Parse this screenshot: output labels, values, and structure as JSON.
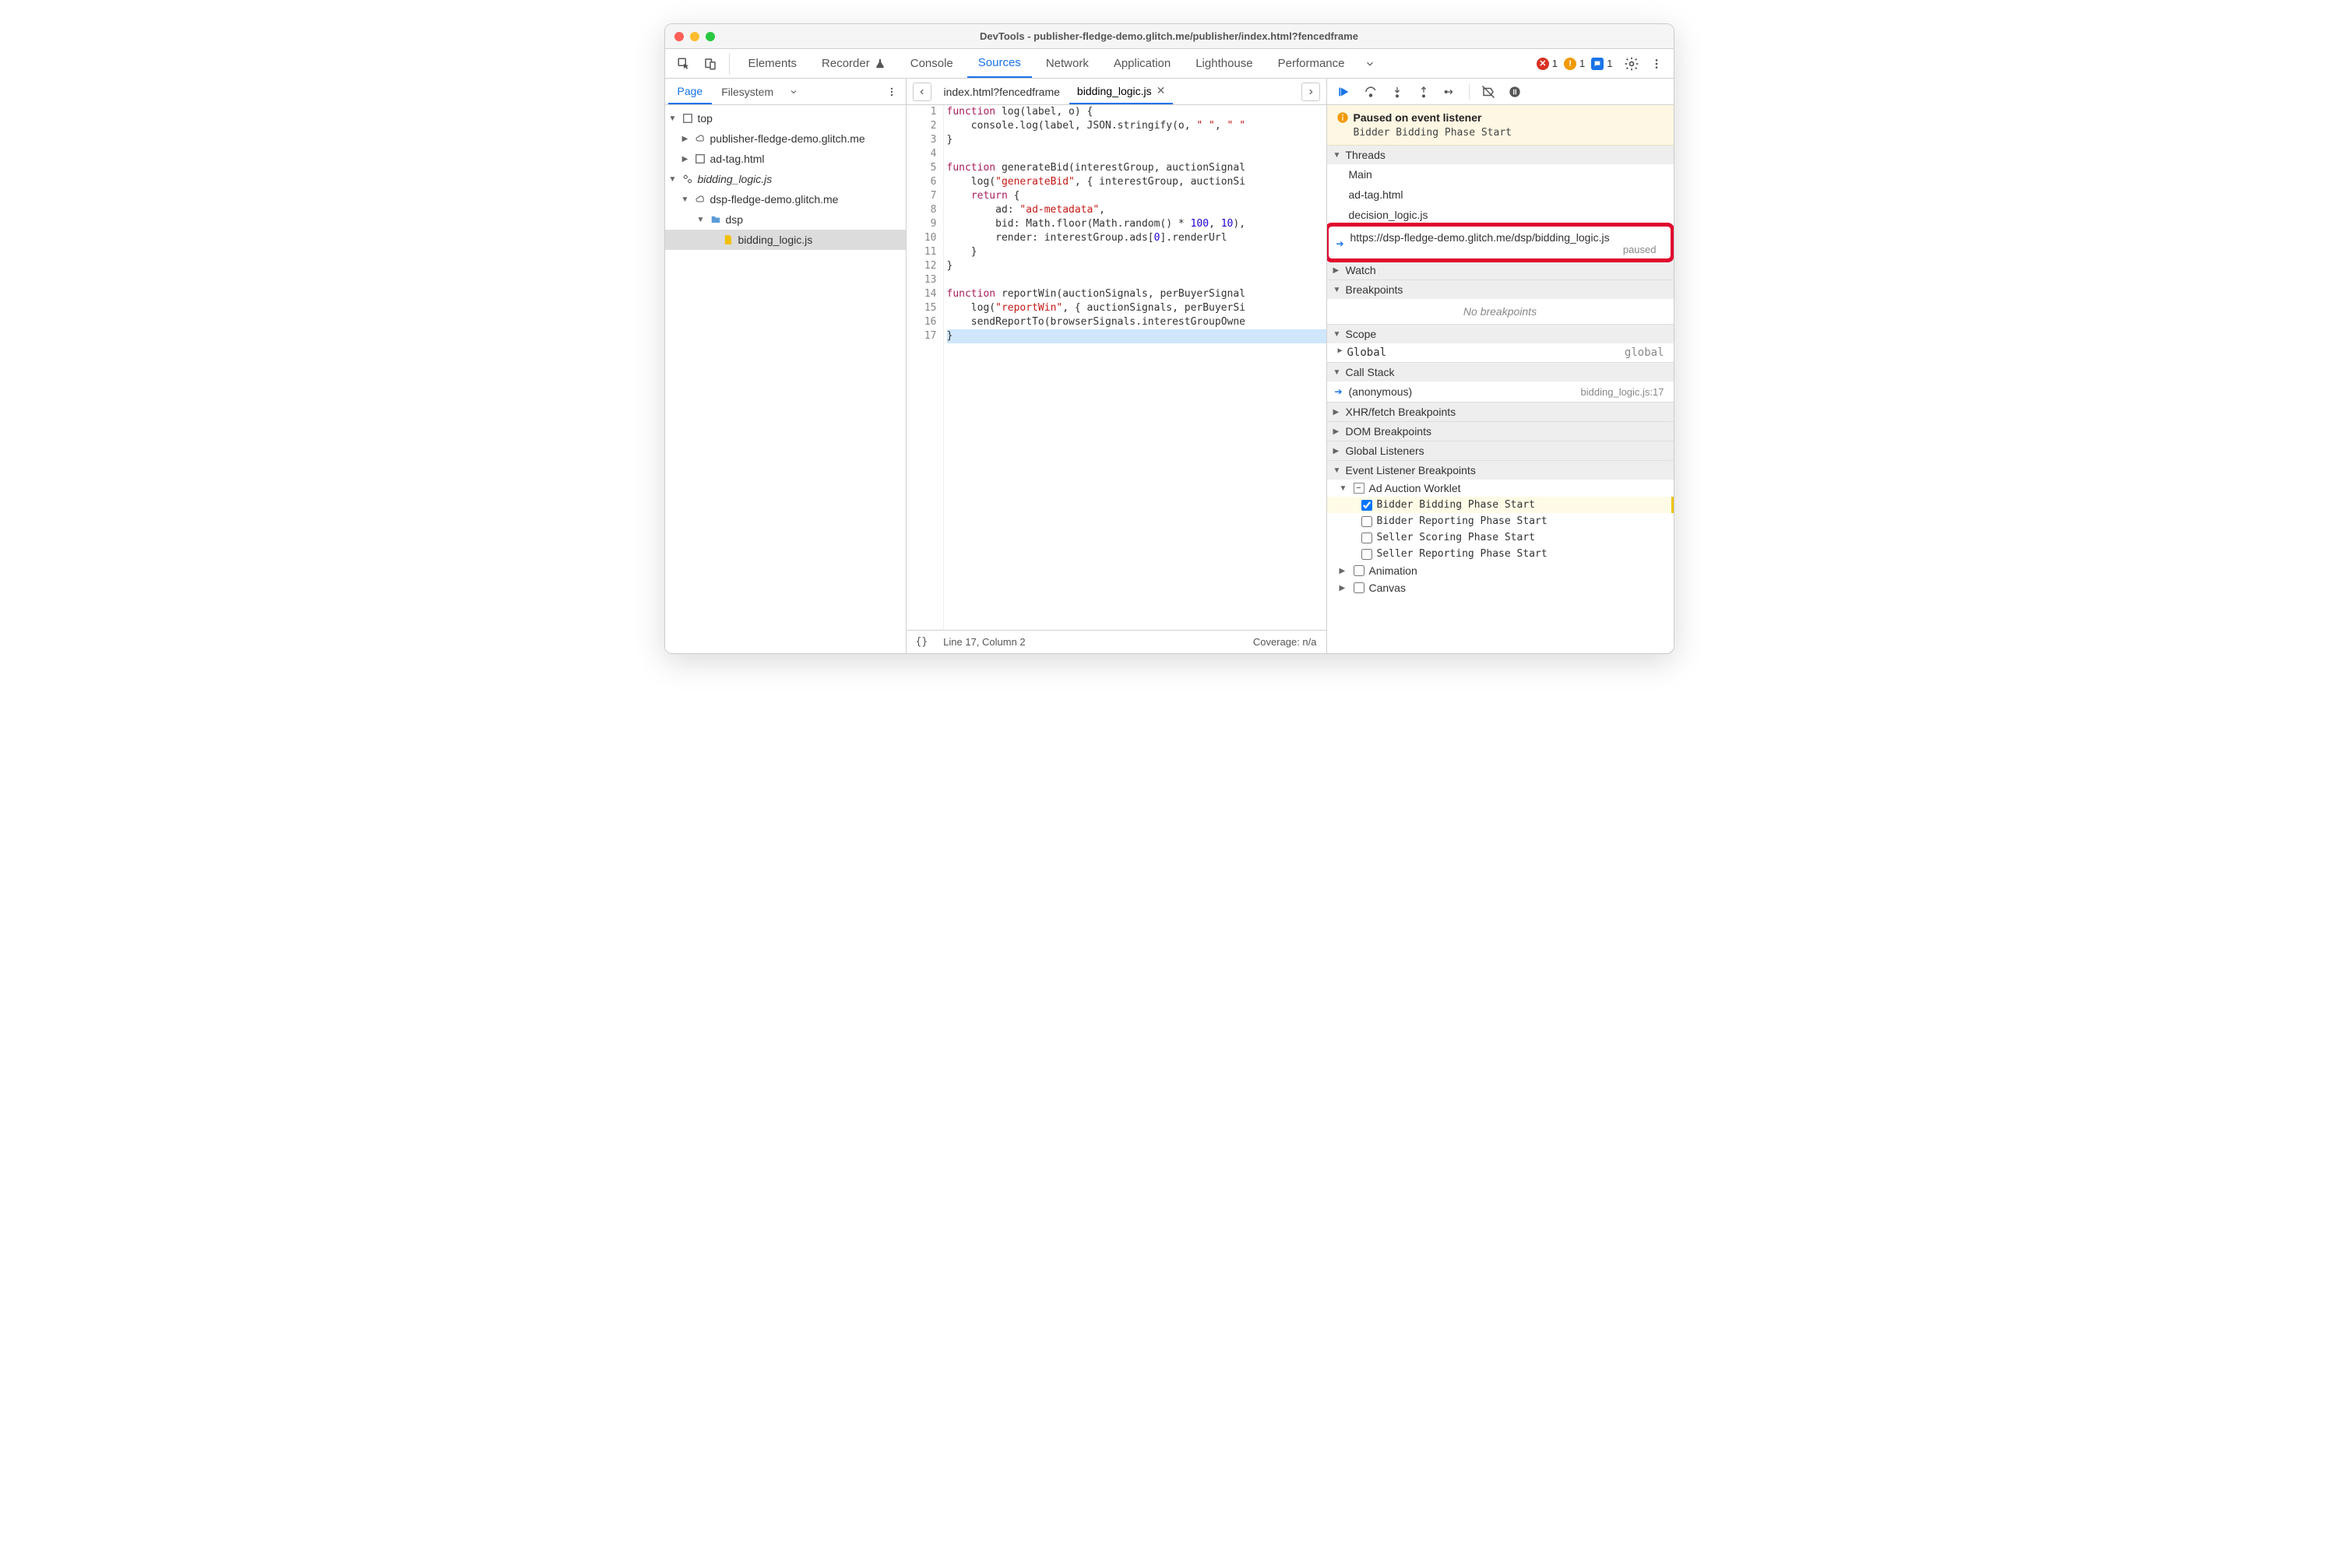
{
  "titlebar": {
    "title": "DevTools - publisher-fledge-demo.glitch.me/publisher/index.html?fencedframe"
  },
  "mainTabs": {
    "items": [
      "Elements",
      "Recorder",
      "Console",
      "Sources",
      "Network",
      "Application",
      "Lighthouse",
      "Performance"
    ],
    "active": "Sources",
    "errors": "1",
    "warnings": "1",
    "messages": "1"
  },
  "navTabs": {
    "page": "Page",
    "filesystem": "Filesystem"
  },
  "tree": {
    "top": "top",
    "pub": "publisher-fledge-demo.glitch.me",
    "adtag": "ad-tag.html",
    "worklet": "bidding_logic.js",
    "dspdomain": "dsp-fledge-demo.glitch.me",
    "dspfolder": "dsp",
    "dspfile": "bidding_logic.js"
  },
  "fileTabs": {
    "t1": "index.html?fencedframe",
    "t2": "bidding_logic.js"
  },
  "code": {
    "l1": "function log(label, o) {",
    "l2": "    console.log(label, JSON.stringify(o, \" \", \" \"",
    "l3": "}",
    "l4": "",
    "l5": "function generateBid(interestGroup, auctionSignal",
    "l6": "    log(\"generateBid\", { interestGroup, auctionSi",
    "l7": "    return {",
    "l8": "        ad: \"ad-metadata\",",
    "l9": "        bid: Math.floor(Math.random() * 100, 10),",
    "l10": "        render: interestGroup.ads[0].renderUrl",
    "l11": "    }",
    "l12": "}",
    "l13": "",
    "l14": "function reportWin(auctionSignals, perBuyerSignal",
    "l15": "    log(\"reportWin\", { auctionSignals, perBuyerSi",
    "l16": "    sendReportTo(browserSignals.interestGroupOwne",
    "l17": "}"
  },
  "status": {
    "pos": "Line 17, Column 2",
    "coverage": "Coverage: n/a"
  },
  "paused": {
    "title": "Paused on event listener",
    "msg": "Bidder Bidding Phase Start"
  },
  "threads": {
    "title": "Threads",
    "items": {
      "main": "Main",
      "adtag": "ad-tag.html",
      "decision": "decision_logic.js",
      "current": "https://dsp-fledge-demo.glitch.me/dsp/bidding_logic.js",
      "paused": "paused"
    }
  },
  "sections": {
    "watch": "Watch",
    "breakpoints": "Breakpoints",
    "nobp": "No breakpoints",
    "scope": "Scope",
    "global": "Global",
    "globalval": "global",
    "callstack": "Call Stack",
    "anon": "(anonymous)",
    "anonloc": "bidding_logic.js:17",
    "xhr": "XHR/fetch Breakpoints",
    "dom": "DOM Breakpoints",
    "gl": "Global Listeners",
    "elb": "Event Listener Breakpoints",
    "adauction": "Ad Auction Worklet",
    "bbps": "Bidder Bidding Phase Start",
    "brps": "Bidder Reporting Phase Start",
    "ssps": "Seller Scoring Phase Start",
    "srps": "Seller Reporting Phase Start",
    "animation": "Animation",
    "canvas": "Canvas"
  }
}
